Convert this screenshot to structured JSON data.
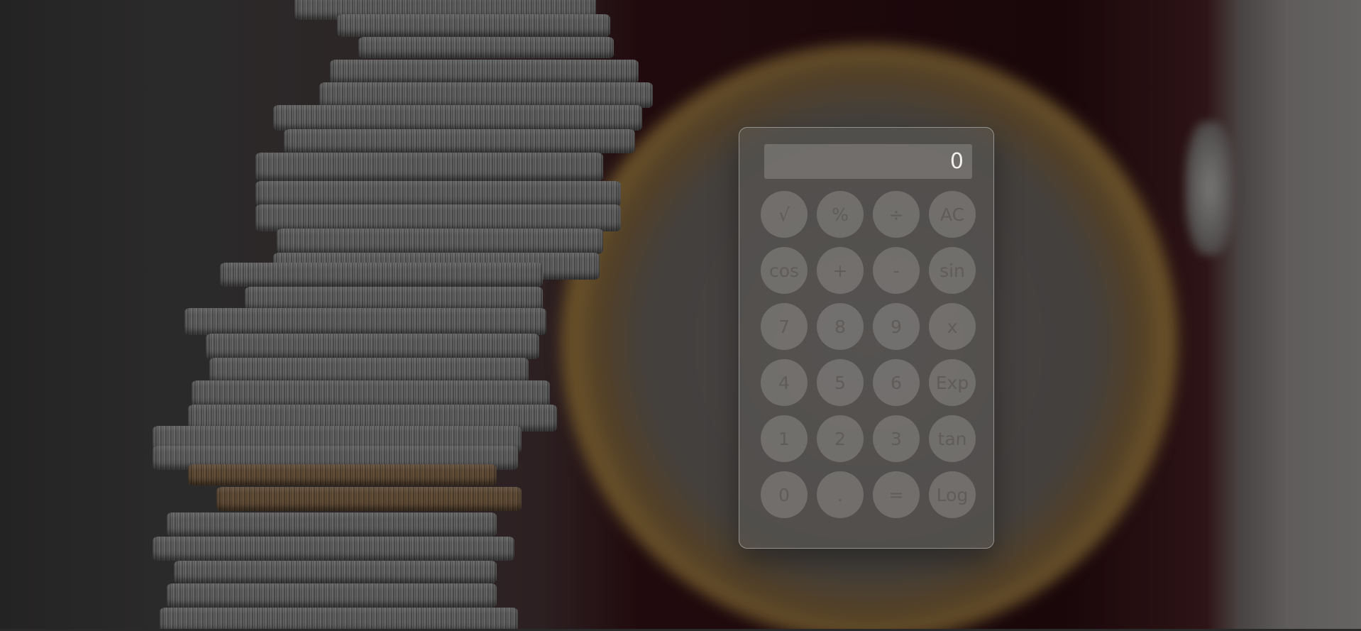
{
  "calculator": {
    "display_value": "0",
    "keys": [
      {
        "label": "√",
        "name": "sqrt-key"
      },
      {
        "label": "%",
        "name": "percent-key"
      },
      {
        "label": "÷",
        "name": "divide-key"
      },
      {
        "label": "AC",
        "name": "clear-key"
      },
      {
        "label": "cos",
        "name": "cos-key"
      },
      {
        "label": "+",
        "name": "plus-key"
      },
      {
        "label": "-",
        "name": "minus-key"
      },
      {
        "label": "sin",
        "name": "sin-key"
      },
      {
        "label": "7",
        "name": "digit-7-key"
      },
      {
        "label": "8",
        "name": "digit-8-key"
      },
      {
        "label": "9",
        "name": "digit-9-key"
      },
      {
        "label": "x",
        "name": "multiply-key"
      },
      {
        "label": "4",
        "name": "digit-4-key"
      },
      {
        "label": "5",
        "name": "digit-5-key"
      },
      {
        "label": "6",
        "name": "digit-6-key"
      },
      {
        "label": "Exp",
        "name": "exp-key"
      },
      {
        "label": "1",
        "name": "digit-1-key"
      },
      {
        "label": "2",
        "name": "digit-2-key"
      },
      {
        "label": "3",
        "name": "digit-3-key"
      },
      {
        "label": "tan",
        "name": "tan-key"
      },
      {
        "label": "0",
        "name": "digit-0-key"
      },
      {
        "label": ".",
        "name": "decimal-key"
      },
      {
        "label": "=",
        "name": "equals-key"
      },
      {
        "label": "Log",
        "name": "log-key"
      }
    ]
  }
}
